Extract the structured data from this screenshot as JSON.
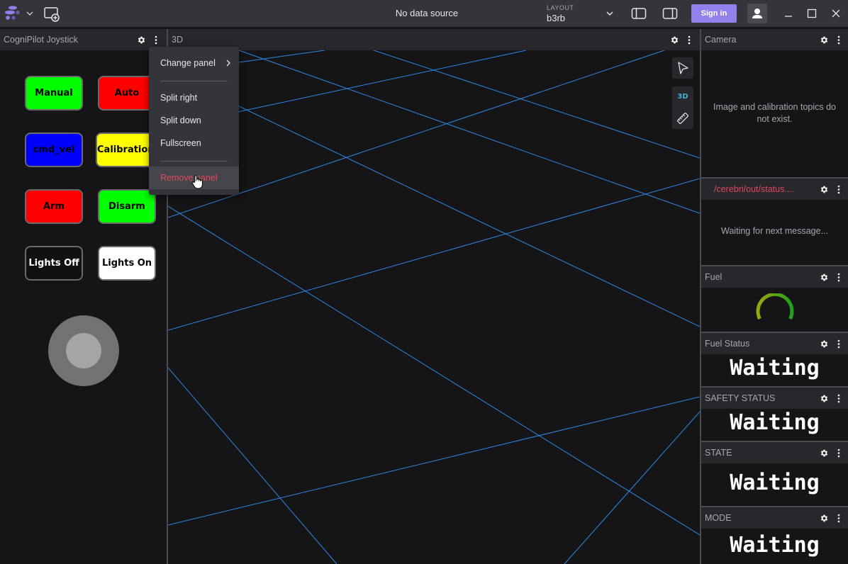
{
  "topbar": {
    "logo_icon": "foxglove-logo-icon",
    "data_source": "No data source",
    "layout_label": "LAYOUT",
    "layout_value": "b3rb",
    "sign_in": "Sign in"
  },
  "panels": {
    "joystick": {
      "title": "CogniPilot Joystick",
      "buttons": [
        {
          "label": "Manual",
          "color": "#00ff00",
          "text_color": "#000000"
        },
        {
          "label": "Auto",
          "color": "#ff0000",
          "text_color": "#000000"
        },
        {
          "label": "cmd_vel",
          "color": "#0000ff",
          "text_color": "#000000"
        },
        {
          "label": "Calibration",
          "color": "#ffff00",
          "text_color": "#000000"
        },
        {
          "label": "Arm",
          "color": "#ff0000",
          "text_color": "#000000"
        },
        {
          "label": "Disarm",
          "color": "#00ff00",
          "text_color": "#000000"
        },
        {
          "label": "Lights Off",
          "color": "#111111",
          "text_color": "#ffffff"
        },
        {
          "label": "Lights On",
          "color": "#ffffff",
          "text_color": "#000000"
        }
      ]
    },
    "three_d": {
      "title": "3D",
      "tools": {
        "select": "select-tool",
        "mode_3d": "3D",
        "measure": "measure-tool"
      },
      "grid_color": "#2f87e0"
    },
    "camera": {
      "title": "Camera",
      "message_line1": "Image and calibration topics do",
      "message_line2": "not exist."
    },
    "cerebri_status": {
      "title": "/cerebri/out/status....",
      "title_color": "#e2485e",
      "message": "Waiting for next message..."
    },
    "fuel": {
      "title": "Fuel",
      "gauge_value": null
    },
    "fuel_status": {
      "title": "Fuel Status",
      "value": "Waiting"
    },
    "safety_status": {
      "title": "SAFETY STATUS",
      "value": "Waiting"
    },
    "state": {
      "title": "STATE",
      "value": "Waiting"
    },
    "mode": {
      "title": "MODE",
      "value": "Waiting"
    }
  },
  "context_menu": {
    "items": [
      {
        "label": "Change panel",
        "submenu": true
      },
      {
        "label": "Split right"
      },
      {
        "label": "Split down"
      },
      {
        "label": "Fullscreen"
      },
      {
        "label": "Remove panel",
        "danger": true
      }
    ]
  }
}
